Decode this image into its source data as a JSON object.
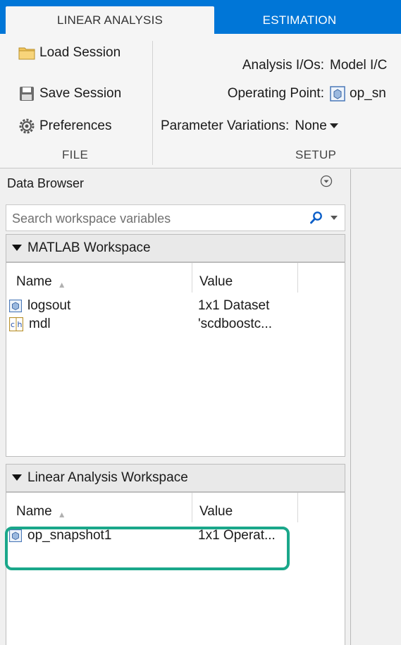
{
  "tabs": [
    {
      "label": "LINEAR ANALYSIS",
      "active": true
    },
    {
      "label": "ESTIMATION",
      "active": false
    }
  ],
  "file_section": {
    "label": "FILE",
    "buttons": [
      {
        "label": "Load Session",
        "icon": "folder-icon"
      },
      {
        "label": "Save Session",
        "icon": "floppy-disk-icon"
      },
      {
        "label": "Preferences",
        "icon": "gear-icon"
      }
    ]
  },
  "setup_section": {
    "label": "SETUP",
    "analysis_ios": {
      "label": "Analysis I/Os:",
      "value": "Model I/C"
    },
    "operating_point": {
      "label": "Operating Point:",
      "value": "op_sn",
      "icon": "operating-point-icon"
    },
    "parameter_variations": {
      "label": "Parameter Variations:",
      "value": "None"
    }
  },
  "data_browser": {
    "title": "Data Browser",
    "search_placeholder": "Search workspace variables",
    "matlab_workspace": {
      "title": "MATLAB Workspace",
      "columns": [
        "Name",
        "Value"
      ],
      "rows": [
        {
          "name": "logsout",
          "value": "1x1 Dataset",
          "icon": "object-icon"
        },
        {
          "name": "mdl",
          "value": "'scdboostc...",
          "icon": "char-icon"
        }
      ]
    },
    "linear_workspace": {
      "title": "Linear Analysis Workspace",
      "columns": [
        "Name",
        "Value"
      ],
      "rows": [
        {
          "name": "op_snapshot1",
          "value": "1x1 Operat...",
          "icon": "object-icon"
        }
      ]
    }
  },
  "colors": {
    "tab_bar": "#0076d7",
    "highlight": "#1aa78a"
  }
}
